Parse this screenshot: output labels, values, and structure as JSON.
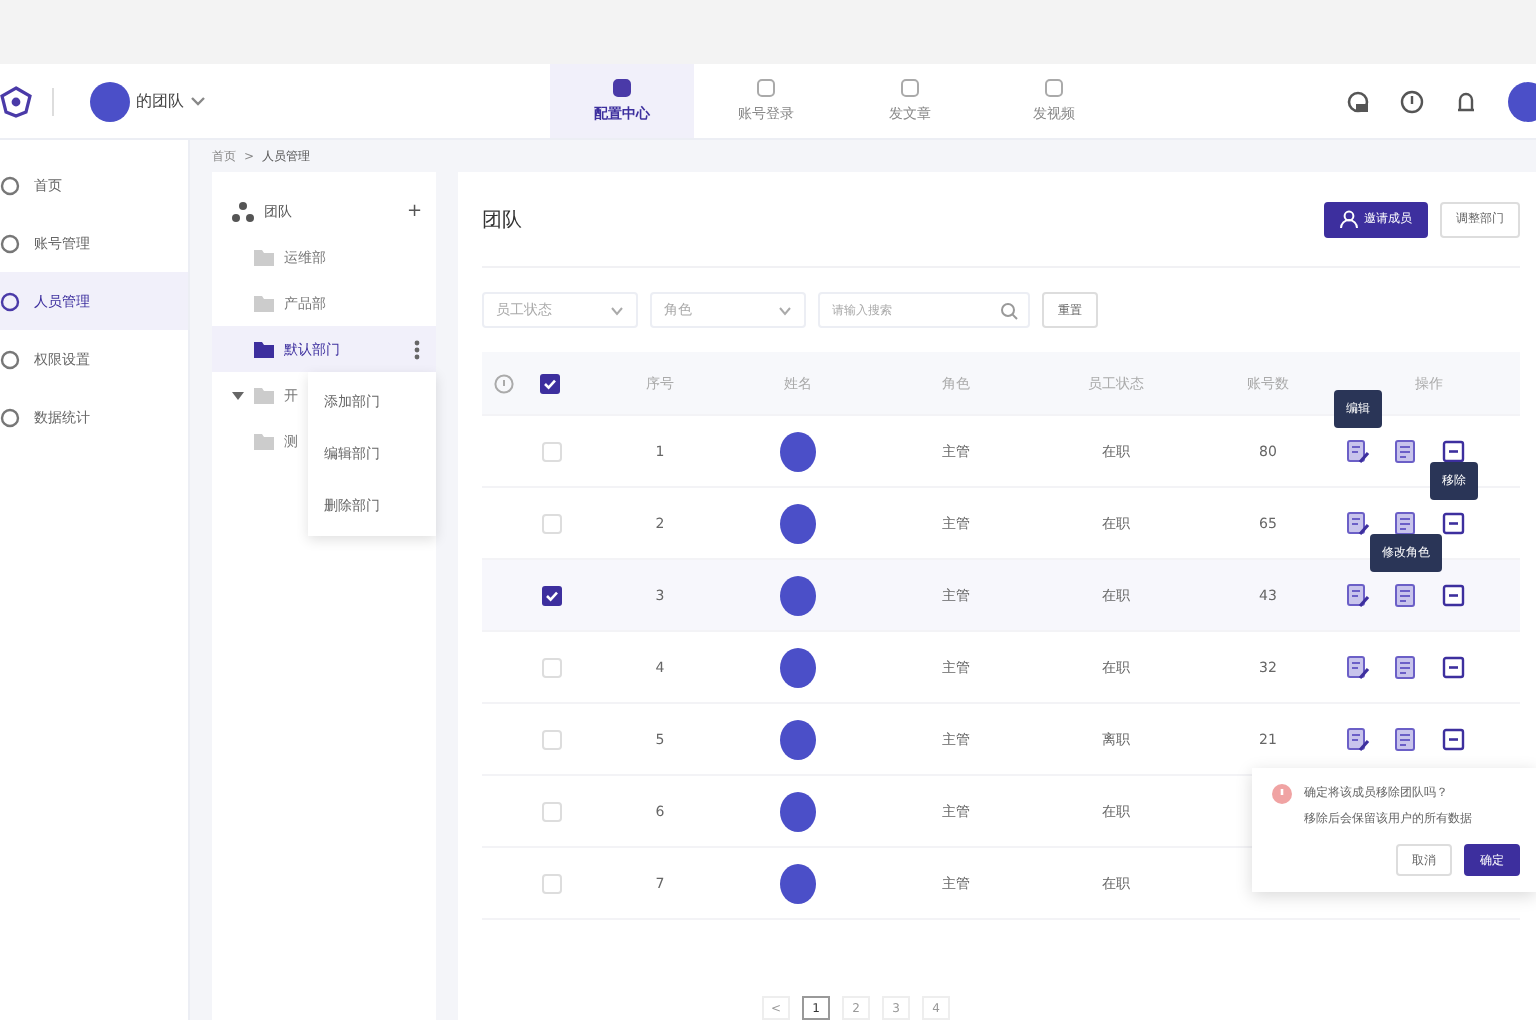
{
  "team": {
    "name": "的团队"
  },
  "top_tabs": [
    {
      "label": "配置中心",
      "selected": true
    },
    {
      "label": "账号登录",
      "selected": false
    },
    {
      "label": "发文章",
      "selected": false
    },
    {
      "label": "发视频",
      "selected": false
    }
  ],
  "sidebar": {
    "items": [
      {
        "label": "首页",
        "selected": false
      },
      {
        "label": "账号管理",
        "selected": false
      },
      {
        "label": "人员管理",
        "selected": true
      },
      {
        "label": "权限设置",
        "selected": false
      },
      {
        "label": "数据统计",
        "selected": false
      }
    ]
  },
  "breadcrumb": [
    "首页",
    ">",
    "人员管理"
  ],
  "tree": {
    "root": "团队",
    "add": "+",
    "children": [
      {
        "label": "运维部",
        "selected": false,
        "expanded": false
      },
      {
        "label": "产品部",
        "selected": false,
        "expanded": false
      },
      {
        "label": "默认部门",
        "selected": true,
        "expanded": false
      },
      {
        "label": "开",
        "selected": false,
        "expanded": true
      },
      {
        "label": "测",
        "selected": false,
        "expanded": false
      }
    ]
  },
  "context_menu": [
    "添加部门",
    "编辑部门",
    "删除部门"
  ],
  "panel": {
    "title": "团队",
    "buttons": [
      {
        "label": "邀请成员",
        "kind": "primary"
      },
      {
        "label": "调整部门",
        "kind": "plain"
      }
    ]
  },
  "filters": {
    "selects": [
      {
        "placeholder": "员工状态"
      },
      {
        "placeholder": "角色"
      }
    ],
    "search": {
      "placeholder": "请输入搜索"
    },
    "reset": "重置"
  },
  "table": {
    "all_checked": true,
    "columns": [
      "序号",
      "姓名",
      "角色",
      "员工状态",
      "账号数",
      "操作"
    ],
    "rows": [
      {
        "index": "1",
        "role": "主管",
        "status": "在职",
        "accounts": "80",
        "checked": false
      },
      {
        "index": "2",
        "role": "主管",
        "status": "在职",
        "accounts": "65",
        "checked": false
      },
      {
        "index": "3",
        "role": "主管",
        "status": "在职",
        "accounts": "43",
        "checked": true
      },
      {
        "index": "4",
        "role": "主管",
        "status": "在职",
        "accounts": "32",
        "checked": false
      },
      {
        "index": "5",
        "role": "主管",
        "status": "离职",
        "accounts": "21",
        "checked": false
      },
      {
        "index": "6",
        "role": "主管",
        "status": "在职",
        "checked": false
      },
      {
        "index": "7",
        "role": "主管",
        "status": "在职",
        "checked": false
      }
    ]
  },
  "tooltips": [
    {
      "text": "编辑",
      "kind": "edit"
    },
    {
      "text": "移除",
      "kind": "remove"
    },
    {
      "text": "修改角色",
      "kind": "role"
    }
  ],
  "popconfirm": {
    "lines": [
      "确定将该成员移除团队吗？",
      "移除后会保留该用户的所有数据"
    ],
    "cancel": "取消",
    "ok": "确定"
  },
  "pagination": {
    "prev": "<",
    "pages": [
      {
        "label": "1",
        "selected": true
      },
      {
        "label": "2",
        "selected": false
      },
      {
        "label": "3",
        "selected": false
      },
      {
        "label": "4",
        "selected": false
      }
    ]
  }
}
